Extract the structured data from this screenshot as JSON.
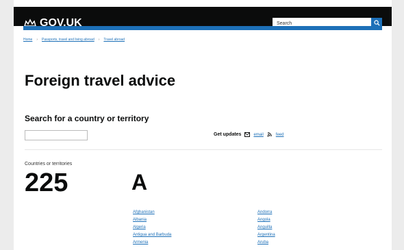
{
  "header": {
    "logo_text": "GOV.UK",
    "search_placeholder": "Search"
  },
  "breadcrumb": [
    "Home",
    "Passports, travel and living abroad",
    "Travel abroad"
  ],
  "page": {
    "title": "Foreign travel advice",
    "search_heading": "Search for a country or territory",
    "get_updates_label": "Get updates",
    "email_link": "email",
    "feed_link": "feed",
    "count_label": "Countries or territories",
    "count_value": "225",
    "letter": "A"
  },
  "countries": {
    "left": [
      "Afghanistan",
      "Albania",
      "Algeria",
      "Antigua and Barbuda",
      "Armenia"
    ],
    "right": [
      "Andorra",
      "Angola",
      "Anguilla",
      "Argentina",
      "Aruba"
    ]
  },
  "colors": {
    "header": "#0b0c0c",
    "accent_blue": "#1d70b8",
    "text": "#0b0c0c"
  },
  "icons": {
    "logo": "crown-icon",
    "search": "search-icon",
    "email": "email-icon",
    "feed": "feed-icon"
  }
}
